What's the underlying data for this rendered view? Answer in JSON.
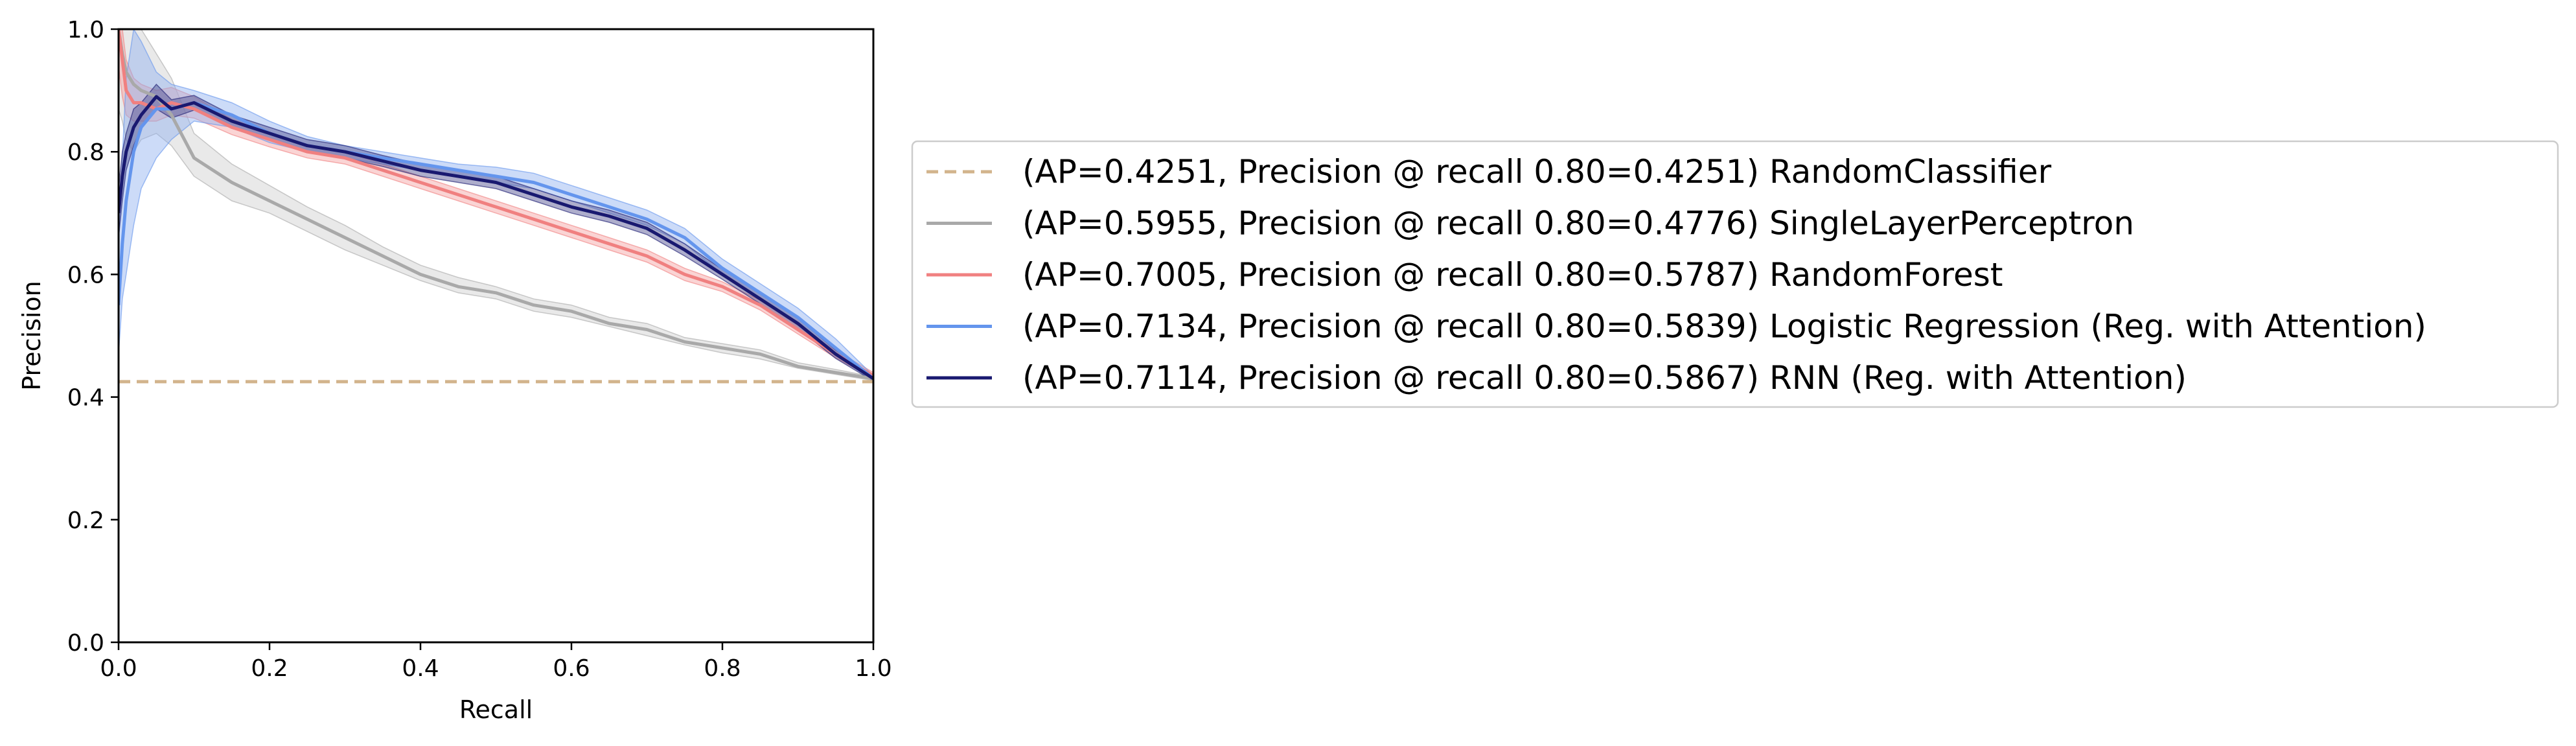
{
  "chart_data": {
    "type": "line",
    "xlabel": "Recall",
    "ylabel": "Precision",
    "xlim": [
      0.0,
      1.0
    ],
    "ylim": [
      0.0,
      1.0
    ],
    "xticks": [
      "0.0",
      "0.2",
      "0.4",
      "0.6",
      "0.8",
      "1.0"
    ],
    "yticks": [
      "0.0",
      "0.2",
      "0.4",
      "0.6",
      "0.8",
      "1.0"
    ],
    "grid": false,
    "legend_position": "right",
    "series": [
      {
        "name": "(AP=0.4251, Precision @ recall 0.80=0.4251) RandomClassifier",
        "color": "#d2b48c",
        "dashed": true,
        "x": [
          0.0,
          1.0
        ],
        "y": [
          0.4251,
          0.4251
        ],
        "lower": [],
        "upper": []
      },
      {
        "name": "(AP=0.5955, Precision @ recall 0.80=0.4776) SingleLayerPerceptron",
        "color": "#a9a9a9",
        "fill": "#cfcfcf",
        "dashed": false,
        "x": [
          0.0,
          0.005,
          0.01,
          0.02,
          0.03,
          0.05,
          0.07,
          0.1,
          0.15,
          0.2,
          0.25,
          0.3,
          0.35,
          0.4,
          0.45,
          0.5,
          0.55,
          0.6,
          0.65,
          0.7,
          0.75,
          0.8,
          0.85,
          0.9,
          0.95,
          1.0
        ],
        "y": [
          1.0,
          0.96,
          0.93,
          0.91,
          0.9,
          0.89,
          0.86,
          0.79,
          0.75,
          0.72,
          0.69,
          0.66,
          0.63,
          0.6,
          0.58,
          0.57,
          0.55,
          0.54,
          0.52,
          0.51,
          0.49,
          0.48,
          0.47,
          0.45,
          0.44,
          0.43
        ],
        "lower": [
          0.87,
          0.85,
          0.82,
          0.8,
          0.82,
          0.83,
          0.81,
          0.76,
          0.72,
          0.7,
          0.67,
          0.64,
          0.615,
          0.59,
          0.57,
          0.56,
          0.54,
          0.53,
          0.515,
          0.5,
          0.485,
          0.472,
          0.462,
          0.447,
          0.437,
          0.427
        ],
        "upper": [
          1.0,
          1.0,
          1.0,
          1.0,
          1.0,
          0.96,
          0.92,
          0.83,
          0.78,
          0.745,
          0.71,
          0.68,
          0.645,
          0.615,
          0.595,
          0.58,
          0.56,
          0.55,
          0.53,
          0.52,
          0.497,
          0.487,
          0.477,
          0.456,
          0.445,
          0.433
        ]
      },
      {
        "name": "(AP=0.7005, Precision @ recall 0.80=0.5787) RandomForest",
        "color": "#f08080",
        "fill": "#f5a0a0",
        "dashed": false,
        "x": [
          0.0,
          0.005,
          0.01,
          0.02,
          0.03,
          0.05,
          0.07,
          0.1,
          0.15,
          0.2,
          0.25,
          0.3,
          0.35,
          0.4,
          0.45,
          0.5,
          0.55,
          0.6,
          0.65,
          0.7,
          0.75,
          0.8,
          0.85,
          0.9,
          0.95,
          1.0
        ],
        "y": [
          1.0,
          0.95,
          0.9,
          0.88,
          0.88,
          0.87,
          0.88,
          0.87,
          0.84,
          0.82,
          0.8,
          0.79,
          0.77,
          0.75,
          0.73,
          0.71,
          0.69,
          0.67,
          0.65,
          0.63,
          0.6,
          0.58,
          0.55,
          0.51,
          0.47,
          0.435
        ],
        "lower": [
          0.94,
          0.89,
          0.86,
          0.85,
          0.85,
          0.85,
          0.86,
          0.855,
          0.828,
          0.808,
          0.79,
          0.78,
          0.76,
          0.74,
          0.72,
          0.7,
          0.68,
          0.66,
          0.64,
          0.62,
          0.59,
          0.572,
          0.542,
          0.503,
          0.464,
          0.43
        ],
        "upper": [
          1.0,
          1.0,
          0.95,
          0.92,
          0.91,
          0.9,
          0.905,
          0.89,
          0.853,
          0.832,
          0.81,
          0.8,
          0.78,
          0.76,
          0.74,
          0.72,
          0.7,
          0.68,
          0.66,
          0.64,
          0.61,
          0.588,
          0.558,
          0.517,
          0.476,
          0.44
        ]
      },
      {
        "name": "(AP=0.7134, Precision @ recall 0.80=0.5839) Logistic Regression (Reg. with Attention)",
        "color": "#6495ed",
        "fill": "#8fb0f0",
        "dashed": false,
        "x": [
          0.0,
          0.005,
          0.01,
          0.02,
          0.03,
          0.05,
          0.07,
          0.1,
          0.15,
          0.2,
          0.25,
          0.3,
          0.35,
          0.4,
          0.45,
          0.5,
          0.55,
          0.6,
          0.65,
          0.7,
          0.75,
          0.8,
          0.85,
          0.9,
          0.95,
          1.0
        ],
        "y": [
          0.55,
          0.65,
          0.72,
          0.8,
          0.84,
          0.87,
          0.87,
          0.88,
          0.86,
          0.83,
          0.81,
          0.8,
          0.79,
          0.78,
          0.77,
          0.76,
          0.75,
          0.73,
          0.71,
          0.69,
          0.66,
          0.61,
          0.57,
          0.53,
          0.48,
          0.43
        ],
        "lower": [
          0.47,
          0.56,
          0.6,
          0.68,
          0.74,
          0.79,
          0.82,
          0.85,
          0.84,
          0.815,
          0.8,
          0.79,
          0.78,
          0.77,
          0.76,
          0.75,
          0.74,
          0.72,
          0.7,
          0.68,
          0.65,
          0.6,
          0.56,
          0.52,
          0.47,
          0.425
        ],
        "upper": [
          0.65,
          0.79,
          0.92,
          1.0,
          0.98,
          0.93,
          0.91,
          0.9,
          0.88,
          0.85,
          0.825,
          0.81,
          0.8,
          0.79,
          0.78,
          0.775,
          0.765,
          0.745,
          0.725,
          0.705,
          0.675,
          0.625,
          0.585,
          0.545,
          0.495,
          0.435
        ]
      },
      {
        "name": "(AP=0.7114, Precision @ recall 0.80=0.5867) RNN (Reg. with Attention)",
        "color": "#191970",
        "fill": "#4b4b8f",
        "dashed": false,
        "x": [
          0.0,
          0.005,
          0.01,
          0.02,
          0.03,
          0.05,
          0.07,
          0.1,
          0.15,
          0.2,
          0.25,
          0.3,
          0.35,
          0.4,
          0.45,
          0.5,
          0.55,
          0.6,
          0.65,
          0.7,
          0.75,
          0.8,
          0.85,
          0.9,
          0.95,
          1.0
        ],
        "y": [
          0.7,
          0.76,
          0.8,
          0.84,
          0.86,
          0.89,
          0.87,
          0.88,
          0.85,
          0.83,
          0.81,
          0.8,
          0.785,
          0.77,
          0.76,
          0.75,
          0.73,
          0.71,
          0.695,
          0.675,
          0.64,
          0.6,
          0.56,
          0.52,
          0.47,
          0.43
        ],
        "lower": [
          0.66,
          0.72,
          0.77,
          0.81,
          0.84,
          0.87,
          0.855,
          0.868,
          0.84,
          0.82,
          0.8,
          0.79,
          0.776,
          0.76,
          0.75,
          0.74,
          0.72,
          0.7,
          0.685,
          0.665,
          0.63,
          0.592,
          0.552,
          0.512,
          0.463,
          0.426
        ],
        "upper": [
          0.74,
          0.8,
          0.83,
          0.87,
          0.88,
          0.91,
          0.885,
          0.892,
          0.86,
          0.84,
          0.82,
          0.81,
          0.794,
          0.78,
          0.77,
          0.76,
          0.74,
          0.72,
          0.705,
          0.685,
          0.65,
          0.608,
          0.568,
          0.528,
          0.477,
          0.434
        ]
      }
    ]
  }
}
